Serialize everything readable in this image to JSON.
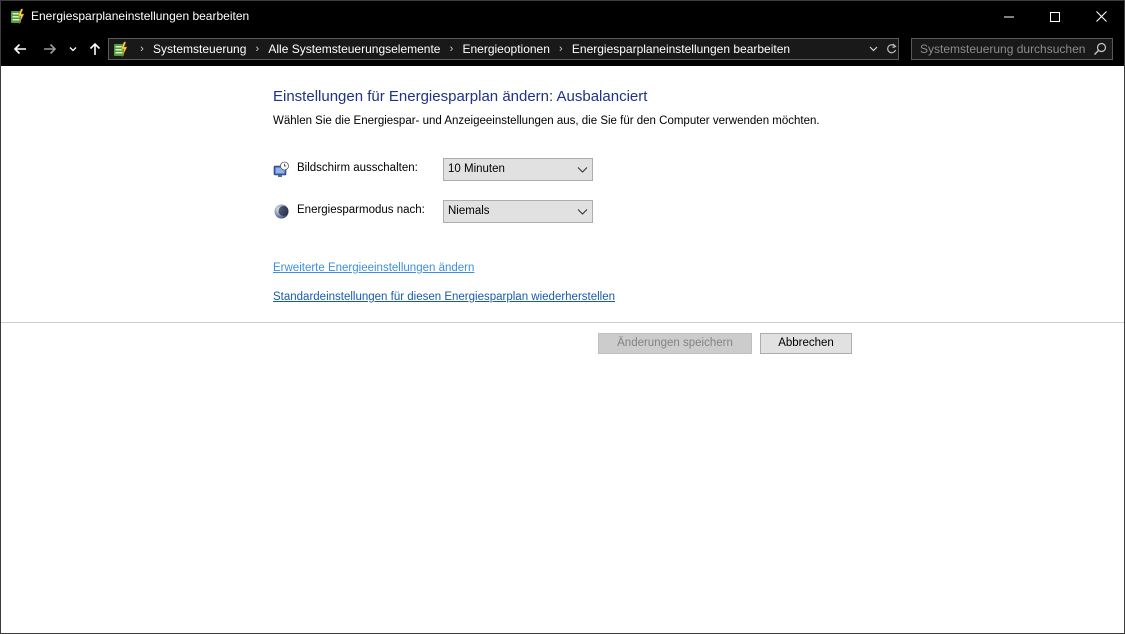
{
  "window": {
    "title": "Energiesparplaneinstellungen bearbeiten",
    "app_icon": "power-options-icon",
    "controls": [
      "minimize-icon",
      "maximize-icon",
      "close-icon"
    ]
  },
  "navigation": {
    "buttons": [
      "back-arrow-icon",
      "forward-arrow-icon",
      "recent-locations-icon",
      "up-arrow-icon"
    ],
    "breadcrumb": [
      "Systemsteuerung",
      "Alle Systemsteuerungselemente",
      "Energieoptionen",
      "Energiesparplaneinstellungen bearbeiten"
    ],
    "separator_icon": "chevron-right-icon"
  },
  "search": {
    "placeholder": "Systemsteuerung durchsuchen",
    "value": ""
  },
  "main": {
    "title": "Einstellungen für Energiesparplan ändern: Ausbalanciert",
    "description": "Wählen Sie die Energiespar- und Anzeigeeinstellungen aus, die Sie für den Computer verwenden möchten.",
    "settings": [
      {
        "label": "Bildschirm ausschalten:",
        "value": "10 Minuten",
        "icon": "monitor-clock-icon"
      },
      {
        "label": "Energiesparmodus nach:",
        "value": "Niemals",
        "icon": "moon-icon"
      }
    ],
    "links": {
      "advanced": "Erweiterte Energieeinstellungen ändern",
      "restore": "Standardeinstellungen für diesen Energiesparplan wiederherstellen"
    },
    "buttons": {
      "save": "Änderungen speichern",
      "cancel": "Abbrechen"
    }
  },
  "colors": {
    "title_blue": "#1e3287",
    "link_light": "#3a8fe0",
    "link_dark": "#1a5aa8",
    "chrome_background": "#000000",
    "content_background": "#ffffff"
  }
}
